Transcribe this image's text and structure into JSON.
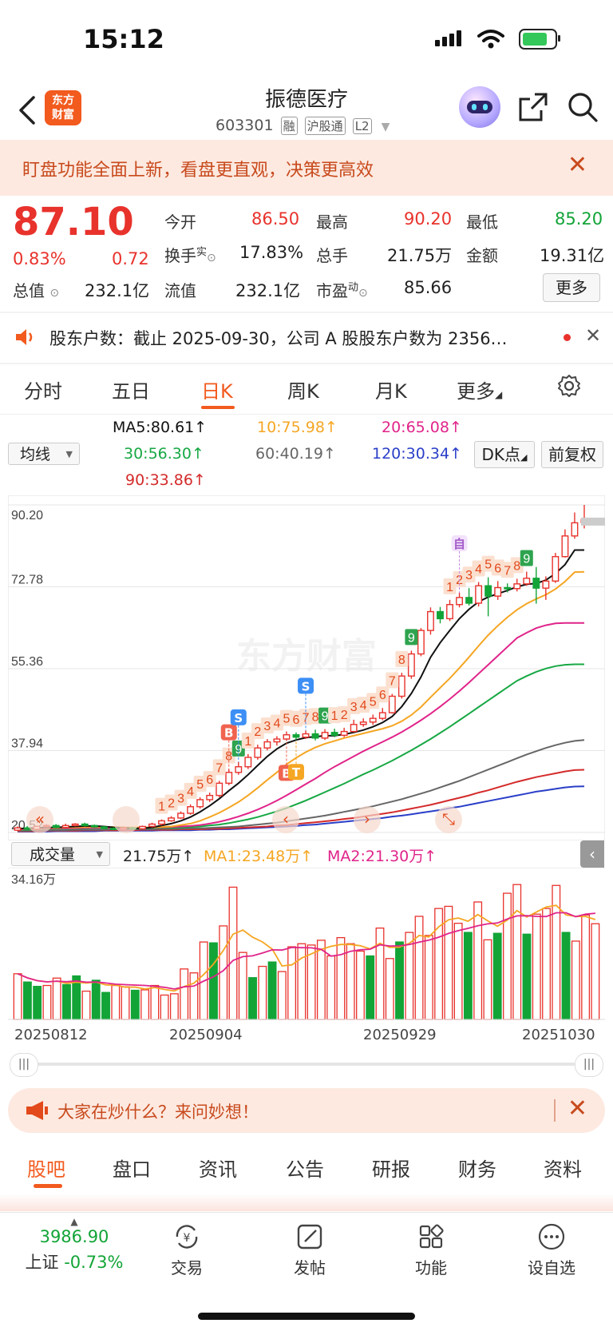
{
  "status_bar": {
    "time": "15:12"
  },
  "header": {
    "title": "振德医疗",
    "code": "603301",
    "tags": [
      "融",
      "沪股通",
      "L2"
    ],
    "logo_text": "东方财富"
  },
  "promo_banner": {
    "text": "盯盘功能全面上新，看盘更直观，决策更高效"
  },
  "quote": {
    "price": "87.10",
    "change_pct": "0.83%",
    "change": "0.72",
    "open_label": "今开",
    "open": "86.50",
    "high_label": "最高",
    "high": "90.20",
    "low_label": "最低",
    "low": "85.20",
    "turnover_label": "换手",
    "turnover_sup": "实",
    "turnover": "17.83%",
    "volume_label": "总手",
    "volume": "21.75万",
    "amount_label": "金额",
    "amount": "19.31亿",
    "mktcap_label": "总值",
    "mktcap": "232.1亿",
    "float_label": "流值",
    "float": "232.1亿",
    "pe_label": "市盈",
    "pe_sup": "动",
    "pe": "85.66",
    "more_label": "更多"
  },
  "notice": {
    "text": "股东户数：截止 2025-09-30，公司 A 股股东户数为 2356…"
  },
  "period_tabs": [
    "分时",
    "五日",
    "日K",
    "周K",
    "月K",
    "更多"
  ],
  "active_period": "日K",
  "ma": {
    "selector": "均线",
    "ma5": "MA5:80.61↑",
    "ma10": "10:75.98↑",
    "ma20": "20:65.08↑",
    "ma30": "30:56.30↑",
    "ma60": "60:40.19↑",
    "ma120": "120:30.34↑",
    "ma90": "90:33.86↑",
    "dk_label": "DK点",
    "adjust_label": "前复权",
    "colors": {
      "ma5": "#111111",
      "ma10": "#f5a623",
      "ma20": "#e0248a",
      "ma30": "#17a844",
      "ma60": "#666666",
      "ma90": "#d42a2a",
      "ma120": "#2a3fc8"
    }
  },
  "volume": {
    "selector": "成交量",
    "value": "21.75万↑",
    "ma1": "MA1:23.48万↑",
    "ma2": "MA2:21.30万↑",
    "max_label": "34.16万"
  },
  "chart_data": {
    "type": "candlestick",
    "y_ticks": [
      "90.20",
      "72.78",
      "55.36",
      "37.94",
      "20.52"
    ],
    "ylim": [
      20.52,
      90.2
    ],
    "x_labels": [
      "20250812",
      "20250904",
      "20250929",
      "20251030"
    ],
    "candles": [
      {
        "o": 21.0,
        "c": 21.5,
        "h": 21.8,
        "l": 20.8
      },
      {
        "o": 21.5,
        "c": 21.2,
        "h": 21.9,
        "l": 21.0
      },
      {
        "o": 21.2,
        "c": 21.8,
        "h": 22.0,
        "l": 21.0
      },
      {
        "o": 21.8,
        "c": 22.0,
        "h": 22.3,
        "l": 21.6
      },
      {
        "o": 22.0,
        "c": 21.6,
        "h": 22.3,
        "l": 21.4
      },
      {
        "o": 21.6,
        "c": 22.0,
        "h": 22.4,
        "l": 21.4
      },
      {
        "o": 22.0,
        "c": 22.3,
        "h": 22.5,
        "l": 21.8
      },
      {
        "o": 22.3,
        "c": 22.0,
        "h": 22.6,
        "l": 21.8
      },
      {
        "o": 22.0,
        "c": 21.7,
        "h": 22.2,
        "l": 21.5
      },
      {
        "o": 21.7,
        "c": 21.4,
        "h": 21.9,
        "l": 21.2
      },
      {
        "o": 21.4,
        "c": 21.2,
        "h": 21.6,
        "l": 21.0
      },
      {
        "o": 21.2,
        "c": 21.5,
        "h": 21.8,
        "l": 21.0
      },
      {
        "o": 21.5,
        "c": 21.3,
        "h": 21.7,
        "l": 21.1
      },
      {
        "o": 21.3,
        "c": 21.8,
        "h": 22.0,
        "l": 21.1
      },
      {
        "o": 21.8,
        "c": 22.3,
        "h": 22.6,
        "l": 21.6
      },
      {
        "o": 22.3,
        "c": 23.0,
        "h": 23.3,
        "l": 22.0
      },
      {
        "o": 23.0,
        "c": 23.6,
        "h": 24.0,
        "l": 22.8
      },
      {
        "o": 23.6,
        "c": 24.6,
        "h": 25.0,
        "l": 23.4
      },
      {
        "o": 24.6,
        "c": 26.0,
        "h": 26.5,
        "l": 24.3
      },
      {
        "o": 26.0,
        "c": 27.5,
        "h": 28.0,
        "l": 25.6
      },
      {
        "o": 27.5,
        "c": 28.4,
        "h": 29.0,
        "l": 27.0
      },
      {
        "o": 28.4,
        "c": 31.0,
        "h": 31.5,
        "l": 28.0
      },
      {
        "o": 31.0,
        "c": 33.3,
        "h": 34.0,
        "l": 30.6
      },
      {
        "o": 33.3,
        "c": 34.5,
        "h": 35.5,
        "l": 32.8
      },
      {
        "o": 34.5,
        "c": 36.5,
        "h": 37.2,
        "l": 34.0
      },
      {
        "o": 36.5,
        "c": 38.5,
        "h": 39.2,
        "l": 36.0
      },
      {
        "o": 38.5,
        "c": 39.8,
        "h": 40.4,
        "l": 38.0
      },
      {
        "o": 39.8,
        "c": 40.4,
        "h": 41.0,
        "l": 39.0
      },
      {
        "o": 40.4,
        "c": 41.3,
        "h": 42.0,
        "l": 40.0
      },
      {
        "o": 41.3,
        "c": 40.8,
        "h": 41.8,
        "l": 40.2
      },
      {
        "o": 40.8,
        "c": 41.5,
        "h": 42.2,
        "l": 40.4
      },
      {
        "o": 41.5,
        "c": 40.6,
        "h": 42.4,
        "l": 40.1
      },
      {
        "o": 40.6,
        "c": 41.8,
        "h": 42.5,
        "l": 40.2
      },
      {
        "o": 41.8,
        "c": 41.2,
        "h": 42.6,
        "l": 40.8
      },
      {
        "o": 41.2,
        "c": 42.0,
        "h": 42.8,
        "l": 40.8
      },
      {
        "o": 42.0,
        "c": 43.5,
        "h": 44.5,
        "l": 41.8
      },
      {
        "o": 43.5,
        "c": 44.0,
        "h": 44.8,
        "l": 43.0
      },
      {
        "o": 44.0,
        "c": 44.8,
        "h": 45.6,
        "l": 43.4
      },
      {
        "o": 44.8,
        "c": 46.0,
        "h": 47.0,
        "l": 44.4
      },
      {
        "o": 46.0,
        "c": 49.5,
        "h": 50.0,
        "l": 45.8
      },
      {
        "o": 49.5,
        "c": 53.8,
        "h": 54.5,
        "l": 49.0
      },
      {
        "o": 53.8,
        "c": 58.5,
        "h": 59.2,
        "l": 53.2
      },
      {
        "o": 58.5,
        "c": 63.5,
        "h": 64.0,
        "l": 58.0
      },
      {
        "o": 63.5,
        "c": 67.5,
        "h": 68.4,
        "l": 62.6
      },
      {
        "o": 67.5,
        "c": 66.0,
        "h": 68.5,
        "l": 65.0
      },
      {
        "o": 66.0,
        "c": 69.0,
        "h": 70.0,
        "l": 65.5
      },
      {
        "o": 69.0,
        "c": 70.5,
        "h": 71.5,
        "l": 68.4
      },
      {
        "o": 70.5,
        "c": 69.3,
        "h": 72.5,
        "l": 68.8
      },
      {
        "o": 69.3,
        "c": 73.0,
        "h": 73.8,
        "l": 68.6
      },
      {
        "o": 73.0,
        "c": 70.8,
        "h": 74.8,
        "l": 66.5
      },
      {
        "o": 70.8,
        "c": 72.6,
        "h": 74.0,
        "l": 70.0
      },
      {
        "o": 72.6,
        "c": 72.4,
        "h": 73.5,
        "l": 71.6
      },
      {
        "o": 72.4,
        "c": 73.4,
        "h": 74.5,
        "l": 71.8
      },
      {
        "o": 73.4,
        "c": 74.6,
        "h": 76.0,
        "l": 73.0
      },
      {
        "o": 74.6,
        "c": 72.5,
        "h": 77.0,
        "l": 69.2
      },
      {
        "o": 72.5,
        "c": 74.0,
        "h": 75.0,
        "l": 70.0
      },
      {
        "o": 74.0,
        "c": 79.2,
        "h": 80.0,
        "l": 73.6
      },
      {
        "o": 79.2,
        "c": 83.6,
        "h": 85.0,
        "l": 79.0
      },
      {
        "o": 83.6,
        "c": 86.4,
        "h": 88.6,
        "l": 83.0
      },
      {
        "o": 86.4,
        "c": 87.1,
        "h": 90.2,
        "l": 85.2
      }
    ],
    "ma_lines": {
      "ma5": [
        21.3,
        21.4,
        21.5,
        21.6,
        21.6,
        21.7,
        21.8,
        21.9,
        21.9,
        21.8,
        21.6,
        21.5,
        21.4,
        21.4,
        21.6,
        22.0,
        22.4,
        23.0,
        23.8,
        24.9,
        26.2,
        27.7,
        29.4,
        31.0,
        32.8,
        34.8,
        36.7,
        38.3,
        39.5,
        40.2,
        40.7,
        40.9,
        41.1,
        41.1,
        41.4,
        41.8,
        42.3,
        43.0,
        43.9,
        45.2,
        47.3,
        50.1,
        53.6,
        57.8,
        60.9,
        63.5,
        66.0,
        68.0,
        69.6,
        70.6,
        71.3,
        72.0,
        72.8,
        73.3,
        73.5,
        74.2,
        75.6,
        77.5,
        80.6,
        80.6
      ],
      "ma10": [
        21.3,
        21.3,
        21.4,
        21.5,
        21.5,
        21.6,
        21.6,
        21.7,
        21.7,
        21.7,
        21.7,
        21.6,
        21.6,
        21.6,
        21.6,
        21.7,
        21.8,
        22.1,
        22.4,
        23.0,
        23.8,
        24.7,
        25.8,
        27.0,
        28.4,
        30.0,
        31.7,
        33.3,
        35.0,
        36.4,
        37.6,
        38.6,
        39.4,
        40.0,
        40.6,
        41.1,
        41.6,
        42.1,
        42.6,
        43.2,
        44.2,
        45.5,
        47.2,
        49.3,
        51.3,
        53.3,
        55.5,
        57.8,
        60.2,
        62.5,
        64.5,
        66.3,
        67.9,
        69.2,
        70.2,
        71.1,
        72.3,
        73.9,
        75.9,
        75.98
      ],
      "ma20": [
        21.2,
        21.2,
        21.3,
        21.3,
        21.4,
        21.4,
        21.4,
        21.5,
        21.5,
        21.5,
        21.5,
        21.5,
        21.5,
        21.5,
        21.6,
        21.6,
        21.7,
        21.8,
        21.9,
        22.1,
        22.4,
        22.8,
        23.3,
        23.9,
        24.6,
        25.4,
        26.3,
        27.3,
        28.4,
        29.6,
        30.8,
        32.0,
        33.3,
        34.5,
        35.6,
        36.7,
        37.8,
        38.8,
        39.8,
        40.8,
        41.9,
        43.1,
        44.4,
        45.8,
        47.3,
        48.9,
        50.6,
        52.4,
        54.3,
        56.2,
        58.1,
        60.0,
        61.9,
        63.0,
        64.0,
        64.6,
        65.0,
        65.08,
        65.1,
        65.1
      ],
      "ma30": [
        21.1,
        21.1,
        21.2,
        21.2,
        21.3,
        21.3,
        21.3,
        21.4,
        21.4,
        21.4,
        21.4,
        21.4,
        21.4,
        21.4,
        21.5,
        21.5,
        21.5,
        21.6,
        21.7,
        21.8,
        22.0,
        22.2,
        22.5,
        22.9,
        23.3,
        23.8,
        24.4,
        25.0,
        25.7,
        26.5,
        27.3,
        28.2,
        29.1,
        30.0,
        30.9,
        31.9,
        32.9,
        33.8,
        34.8,
        35.8,
        36.9,
        38.0,
        39.2,
        40.4,
        41.7,
        43.0,
        44.4,
        45.8,
        47.2,
        48.6,
        50.0,
        51.4,
        52.8,
        53.8,
        54.7,
        55.4,
        55.9,
        56.2,
        56.3,
        56.3
      ],
      "ma60": [
        20.9,
        20.9,
        21.0,
        21.0,
        21.0,
        21.0,
        21.1,
        21.1,
        21.1,
        21.1,
        21.2,
        21.2,
        21.2,
        21.2,
        21.2,
        21.3,
        21.3,
        21.3,
        21.4,
        21.4,
        21.5,
        21.6,
        21.7,
        21.8,
        22.0,
        22.2,
        22.4,
        22.6,
        22.9,
        23.2,
        23.5,
        23.8,
        24.1,
        24.5,
        24.9,
        25.3,
        25.7,
        26.1,
        26.6,
        27.1,
        27.6,
        28.2,
        28.8,
        29.4,
        30.1,
        30.8,
        31.5,
        32.3,
        33.1,
        33.9,
        34.7,
        35.5,
        36.3,
        37.1,
        37.8,
        38.5,
        39.1,
        39.6,
        40.0,
        40.19
      ],
      "ma90": [
        20.8,
        20.8,
        20.8,
        20.9,
        20.9,
        20.9,
        20.9,
        21.0,
        21.0,
        21.0,
        21.0,
        21.0,
        21.0,
        21.1,
        21.1,
        21.1,
        21.1,
        21.2,
        21.2,
        21.2,
        21.3,
        21.3,
        21.4,
        21.5,
        21.6,
        21.7,
        21.8,
        22.0,
        22.1,
        22.3,
        22.5,
        22.7,
        22.9,
        23.1,
        23.4,
        23.6,
        23.9,
        24.2,
        24.5,
        24.8,
        25.2,
        25.6,
        26.0,
        26.4,
        26.9,
        27.4,
        27.9,
        28.4,
        29.0,
        29.5,
        30.1,
        30.7,
        31.3,
        31.8,
        32.3,
        32.7,
        33.1,
        33.5,
        33.8,
        33.86
      ],
      "ma120": [
        20.7,
        20.7,
        20.7,
        20.7,
        20.8,
        20.8,
        20.8,
        20.8,
        20.8,
        20.9,
        20.9,
        20.9,
        20.9,
        20.9,
        20.9,
        21.0,
        21.0,
        21.0,
        21.0,
        21.1,
        21.1,
        21.2,
        21.2,
        21.3,
        21.4,
        21.5,
        21.6,
        21.7,
        21.8,
        21.9,
        22.1,
        22.2,
        22.4,
        22.6,
        22.8,
        23.0,
        23.2,
        23.4,
        23.6,
        23.9,
        24.1,
        24.4,
        24.7,
        25.0,
        25.3,
        25.7,
        26.0,
        26.4,
        26.8,
        27.2,
        27.6,
        28.0,
        28.4,
        28.8,
        29.2,
        29.5,
        29.8,
        30.1,
        30.3,
        30.34
      ]
    },
    "candle_labels": [
      {
        "i": 15,
        "t": "1"
      },
      {
        "i": 16,
        "t": "2"
      },
      {
        "i": 17,
        "t": "3"
      },
      {
        "i": 18,
        "t": "4"
      },
      {
        "i": 19,
        "t": "5"
      },
      {
        "i": 20,
        "t": "6"
      },
      {
        "i": 21,
        "t": "7"
      },
      {
        "i": 22,
        "t": "8"
      },
      {
        "i": 23,
        "t": "9",
        "g": true
      },
      {
        "i": 24,
        "t": "1"
      },
      {
        "i": 25,
        "t": "2"
      },
      {
        "i": 26,
        "t": "3"
      },
      {
        "i": 27,
        "t": "4"
      },
      {
        "i": 28,
        "t": "5"
      },
      {
        "i": 29,
        "t": "6"
      },
      {
        "i": 30,
        "t": "7"
      },
      {
        "i": 31,
        "t": "8"
      },
      {
        "i": 32,
        "t": "9",
        "g": true
      },
      {
        "i": 33,
        "t": "1"
      },
      {
        "i": 34,
        "t": "2"
      },
      {
        "i": 35,
        "t": "3"
      },
      {
        "i": 36,
        "t": "4"
      },
      {
        "i": 37,
        "t": "5"
      },
      {
        "i": 38,
        "t": "6"
      },
      {
        "i": 39,
        "t": "7"
      },
      {
        "i": 40,
        "t": "8"
      },
      {
        "i": 41,
        "t": "9",
        "g": true
      },
      {
        "i": 45,
        "t": "1"
      },
      {
        "i": 46,
        "t": "2"
      },
      {
        "i": 47,
        "t": "3"
      },
      {
        "i": 48,
        "t": "4"
      },
      {
        "i": 49,
        "t": "5"
      },
      {
        "i": 50,
        "t": "6"
      },
      {
        "i": 51,
        "t": "7"
      },
      {
        "i": 52,
        "t": "8"
      },
      {
        "i": 53,
        "t": "9",
        "g": true
      }
    ],
    "signals": [
      {
        "i": 22,
        "t": "B"
      },
      {
        "i": 23,
        "t": "S"
      },
      {
        "i": 30,
        "t": "S"
      },
      {
        "i": 28,
        "t": "B"
      },
      {
        "i": 29,
        "t": "T"
      },
      {
        "i": 46,
        "t": "自"
      }
    ],
    "volumes": [
      10.5,
      8.6,
      7.6,
      7.8,
      9.5,
      8.0,
      10.0,
      6.5,
      9.0,
      6.2,
      7.8,
      7.5,
      6.7,
      6.8,
      7.8,
      5.6,
      5.9,
      11.6,
      10.7,
      17.8,
      17.6,
      21.5,
      30.4,
      15.4,
      9.6,
      12.2,
      13.2,
      11.0,
      16.7,
      17.4,
      17.1,
      18.2,
      14.6,
      18.8,
      17.4,
      15.7,
      14.6,
      21.0,
      14.0,
      17.8,
      20.0,
      23.7,
      19.3,
      25.5,
      26.0,
      22.1,
      20.0,
      27.0,
      18.3,
      19.8,
      29.0,
      31.0,
      19.6,
      24.2,
      25.5,
      30.8,
      20.0,
      18.0,
      24.0,
      22.0
    ],
    "volume_up": [
      true,
      false,
      false,
      true,
      true,
      false,
      false,
      true,
      false,
      false,
      true,
      true,
      false,
      true,
      true,
      true,
      true,
      true,
      true,
      true,
      false,
      true,
      true,
      true,
      false,
      true,
      false,
      true,
      true,
      true,
      true,
      true,
      true,
      true,
      true,
      true,
      false,
      true,
      true,
      false,
      true,
      true,
      true,
      true,
      true,
      true,
      false,
      true,
      true,
      false,
      true,
      true,
      false,
      true,
      true,
      true,
      false,
      true,
      true,
      true
    ],
    "vol_ylim": [
      0,
      34.16
    ]
  },
  "ask_banner": {
    "text": "大家在炒什么？来问妙想！"
  },
  "bottom_tabs": [
    "股吧",
    "盘口",
    "资讯",
    "公告",
    "研报",
    "财务",
    "资料"
  ],
  "active_bottom_tab": "股吧",
  "dock": {
    "index_value": "3986.90",
    "index_name": "上证",
    "index_change": "-0.73%",
    "items": [
      "交易",
      "发帖",
      "功能",
      "设自选"
    ]
  },
  "watermark": "东方财富"
}
